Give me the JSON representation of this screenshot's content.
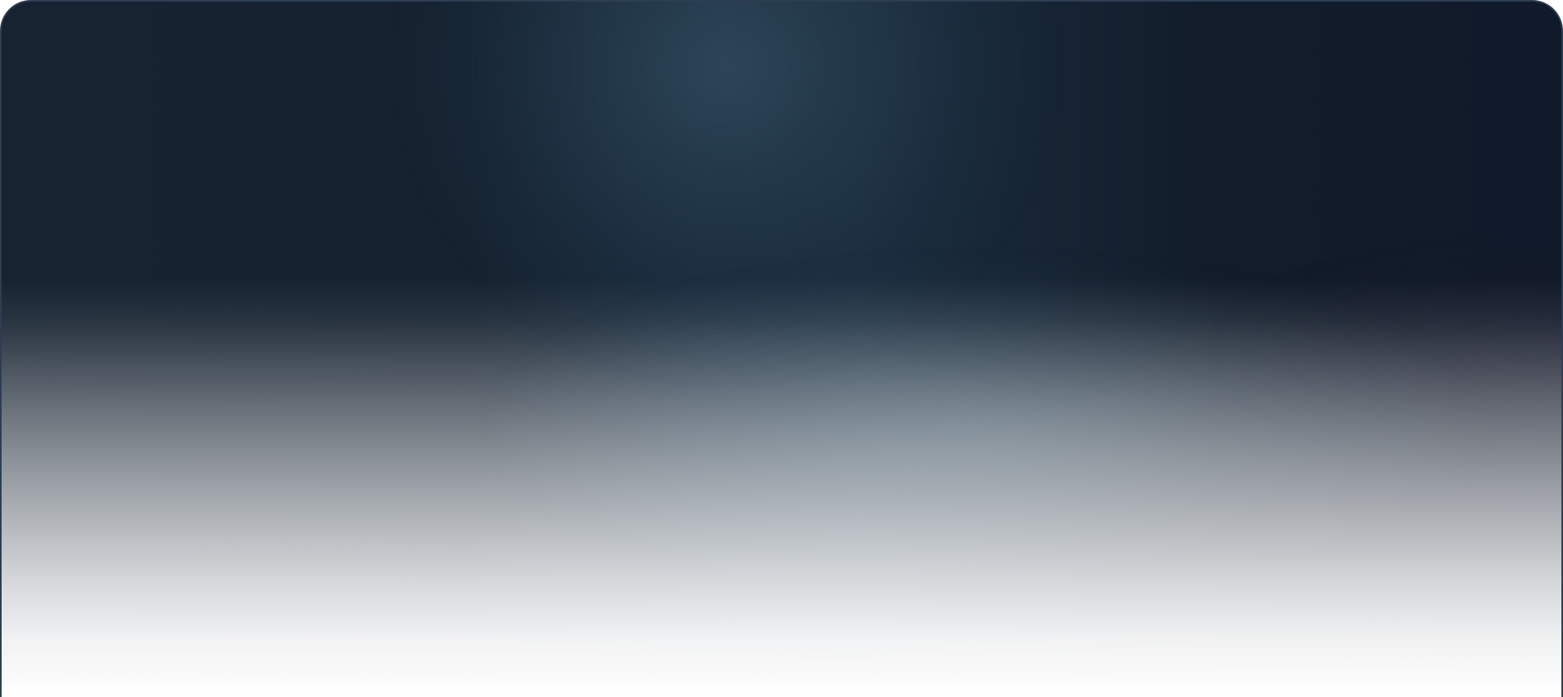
{
  "page": {
    "colors": {
      "panel_border": "#2e3e52",
      "panel_top": "#162130",
      "panel_glow": "#2e485a",
      "panel_fade_end": "#ffffff"
    }
  }
}
